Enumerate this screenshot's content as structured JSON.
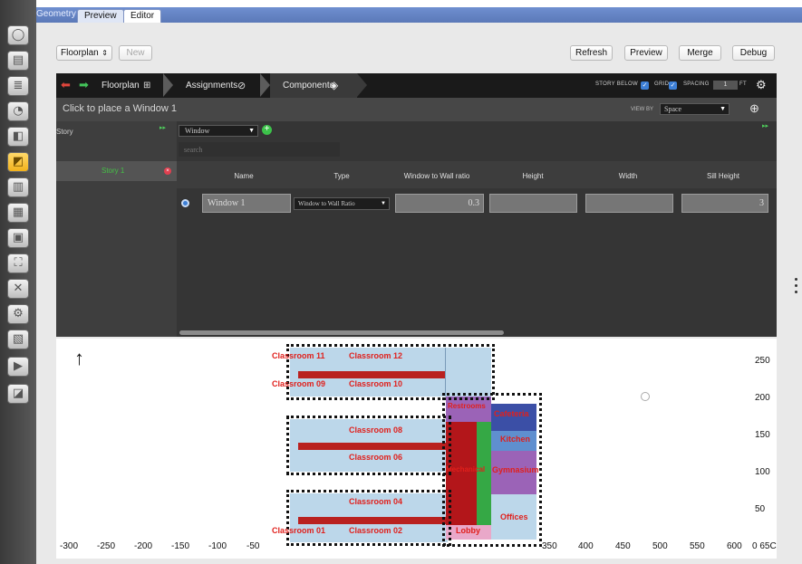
{
  "top": {
    "geometry_label": "Geometry",
    "tabs": [
      "Preview",
      "Editor"
    ]
  },
  "toolbar": {
    "floorplan_select": "Floorplan",
    "new_label": "New",
    "buttons": [
      "Refresh",
      "Preview",
      "Merge",
      "Debug"
    ]
  },
  "header": {
    "crumbs": [
      "Floorplan",
      "Assignments",
      "Components"
    ],
    "story_below": "STORY BELOW",
    "grid": "GRID",
    "spacing": "SPACING",
    "spacing_value": "1",
    "spacing_unit": "FT"
  },
  "status": {
    "message": "Click to place a Window 1",
    "view_by_label": "VIEW BY",
    "view_by_value": "Space"
  },
  "sidebar": {
    "section_label": "Story",
    "stories": [
      "Story 1"
    ]
  },
  "panel": {
    "component_select": "Window",
    "search_placeholder": "search",
    "columns": [
      "Name",
      "Type",
      "Window to Wall ratio",
      "Height",
      "Width",
      "Sill Height"
    ],
    "row": {
      "name": "Window 1",
      "type": "Window to Wall Ratio",
      "ratio": "0.3",
      "height": "",
      "width": "",
      "sill": "3"
    }
  },
  "plan": {
    "x_ticks": [
      "-300",
      "-250",
      "-200",
      "-150",
      "-100",
      "-50",
      "350",
      "400",
      "450",
      "500",
      "550",
      "600",
      "0 65C"
    ],
    "y_ticks": [
      "250",
      "200",
      "150",
      "100",
      "50"
    ],
    "rooms": [
      "Classroom 11",
      "Classroom 12",
      "Classroom 09",
      "Classroom 10",
      "Classroom 08",
      "Classroom 06",
      "Classroom 02",
      "Classroom 04",
      "Classroom 01",
      "Lobby",
      "Offices",
      "Kitchen",
      "Cafeteria",
      "Gymnasium",
      "Restrooms",
      "Mechanical"
    ]
  },
  "colors": {
    "accent": "#3d7fd6",
    "room_label": "#e0201c"
  }
}
